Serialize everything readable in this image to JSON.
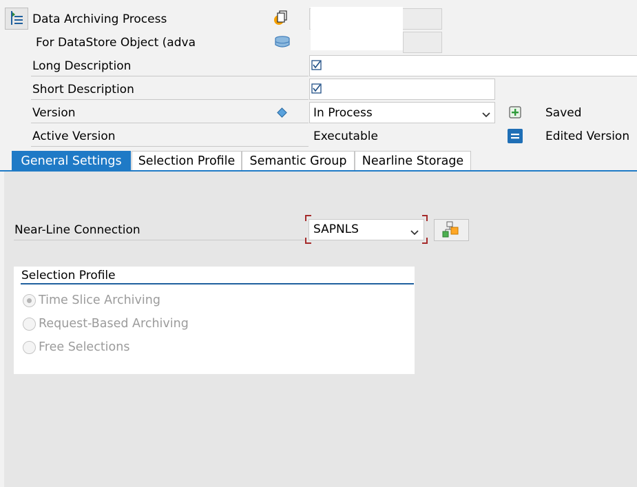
{
  "header": {
    "title": "Data Archiving Process",
    "subtitle": "For DataStore Object (adva"
  },
  "fields": {
    "long_description": "Long Description",
    "short_description": "Short Description",
    "version": "Version",
    "version_value": "In Process",
    "version_status": "Saved",
    "active_version": "Active Version",
    "active_version_value": "Executable",
    "active_version_status": "Edited Version"
  },
  "tabs": [
    {
      "label": "General Settings"
    },
    {
      "label": "Selection Profile"
    },
    {
      "label": "Semantic Group"
    },
    {
      "label": "Nearline Storage"
    }
  ],
  "general": {
    "nearline_label": "Near-Line Connection",
    "nearline_value": "SAPNLS"
  },
  "selection_profile": {
    "title": "Selection Profile",
    "options": [
      {
        "label": "Time Slice Archiving",
        "selected": true
      },
      {
        "label": "Request-Based Archiving",
        "selected": false
      },
      {
        "label": "Free Selections",
        "selected": false
      }
    ]
  },
  "colors": {
    "accent": "#1f7ac6",
    "required_marker": "#a52a2a"
  }
}
